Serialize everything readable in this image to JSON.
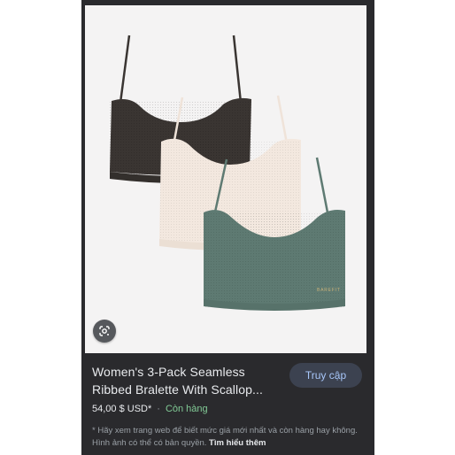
{
  "product": {
    "title": "Women's 3-Pack Seamless Ribbed Bralette With Scallop...",
    "price": "54,00 $ USD*",
    "separator": "·",
    "availability": "Còn hàng",
    "visit_label": "Truy cập",
    "disclaimer": "* Hãy xem trang web để biết mức giá mới nhất và còn hàng hay không. Hình ảnh có thể có bản quyền.",
    "learn_more": "Tìm hiểu thêm",
    "image_brand_mark": "BAREFIT"
  },
  "icons": {
    "lens": "google-lens-icon"
  },
  "colors": {
    "panel_bg": "#2a2a2d",
    "image_bg": "#f4f3f3",
    "bralette_dark": "#3a3532",
    "bralette_cream": "#f3e8df",
    "bralette_sage": "#5e7a72",
    "stock_green": "#81c995",
    "button_text": "#a8c7fa"
  }
}
